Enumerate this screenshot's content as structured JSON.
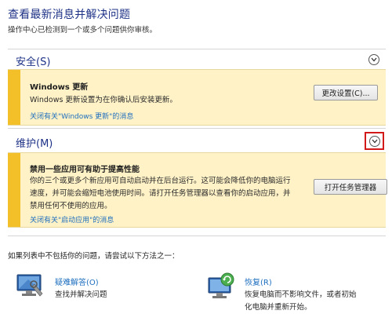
{
  "header": {
    "title": "查看最新消息并解决问题",
    "subtitle": "操作中心已检测到一个或多个问题供你审核。"
  },
  "security": {
    "title": "安全(S)",
    "chevron_icon": "chevron-down-icon",
    "card": {
      "title": "Windows 更新",
      "body": "Windows 更新设置为在你确认后安装更新。",
      "link": "关闭有关\"Windows 更新\"的消息",
      "button": "更改设置(C)..."
    }
  },
  "maintenance": {
    "title": "维护(M)",
    "chevron_icon": "chevron-down-icon",
    "card": {
      "title": "禁用一些应用可有助于提高性能",
      "body_lines": [
        "你的三个或更多个新应用可自动启动并在后台运行。这可能会降低你的电脑运行",
        "速度，并可能会缩短电池使用时间。请打开任务管理器以查看你的启动应用，并",
        "禁用任何不使用的应用。"
      ],
      "link": "关闭有关\"启动应用\"的消息",
      "button": "打开任务管理器"
    }
  },
  "footer": {
    "text": "如果列表中不包括你的问题，请尝试以下方法之一：",
    "options": [
      {
        "icon": "troubleshooting-icon",
        "label": "疑难解答(O)",
        "desc": "查找并解决问题"
      },
      {
        "icon": "recovery-icon",
        "label": "恢复(R)",
        "desc_lines": [
          "恢复电脑而不影响文件，或者初始",
          "化电脑并重新开始。"
        ]
      }
    ]
  },
  "colors": {
    "accent_bar": "#f4c029",
    "card_bg": "#fff2c6",
    "title_blue": "#1e3287",
    "link_blue": "#1e6fbf",
    "highlight_red": "#d21a1a"
  }
}
